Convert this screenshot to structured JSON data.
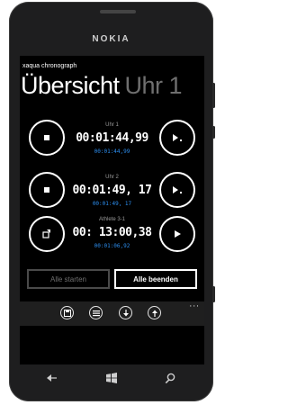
{
  "device": {
    "brand": "NOKIA"
  },
  "app": {
    "name": "xaqua chronograph",
    "page_title": "Übersicht",
    "next_page_title": "Uhr 1"
  },
  "timers": [
    {
      "name": "Uhr 1",
      "time": "00:01:44,99",
      "lap": "00:01:44,99",
      "left_icon": "stop-icon",
      "right_icon": "lap-icon"
    },
    {
      "name": "Uhr 2",
      "time": "00:01:49, 17",
      "lap": "00:01:49, 17",
      "left_icon": "stop-icon",
      "right_icon": "lap-icon"
    },
    {
      "name": "Athlete 3-1",
      "time": "00: 13:00,38",
      "lap": "00:01:06,92",
      "left_icon": "reset-icon",
      "right_icon": "play-icon"
    }
  ],
  "buttons": {
    "start_all": "Alle starten",
    "stop_all": "Alle beenden"
  },
  "appbar": {
    "icons": [
      "save-icon",
      "list-icon",
      "download-icon",
      "upload-icon"
    ],
    "more": "···"
  },
  "nav": {
    "icons": [
      "back-icon",
      "windows-icon",
      "search-icon"
    ]
  },
  "colors": {
    "accent": "#2c8ef0",
    "background": "#000000",
    "disabled": "#6f6f6f"
  }
}
